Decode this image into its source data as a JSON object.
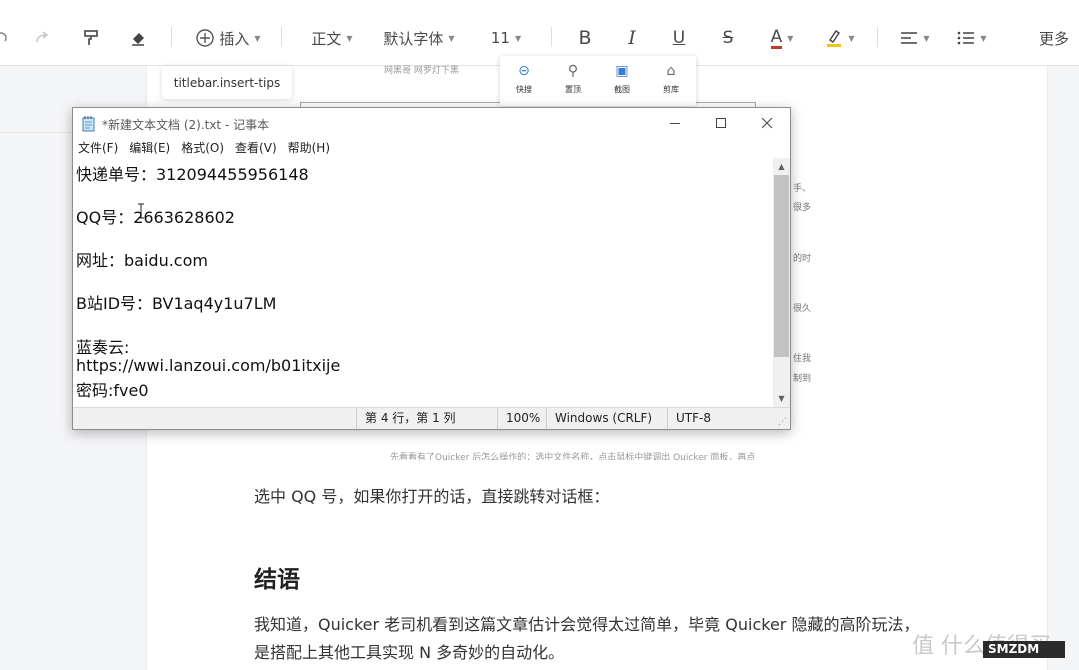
{
  "toolbar": {
    "insert_label": "插入",
    "style_value": "正文",
    "font_value": "默认字体",
    "size_value": "11",
    "bold": "B",
    "italic": "I",
    "underline": "U",
    "strike": "S",
    "font_color": "A",
    "more_label": "更多",
    "accent_color": "#c0392b",
    "highlight_color": "#f1c40f"
  },
  "tooltip": "titlebar.insert-tips",
  "background_fragments": {
    "top_text": "网黑哥   网罗灯下黑",
    "panel_items": [
      "快搜",
      "置顶",
      "截图",
      "剪库"
    ],
    "right_text": [
      "手、",
      "很多",
      "的时",
      "很久",
      "住我",
      "制到"
    ],
    "bottom_text": "先看看有了Quicker 后怎么操作的：选中文件名称，点击鼠标中键调出 Quicker 面板，再点"
  },
  "notepad": {
    "title": "*新建文本文档 (2).txt - 记事本",
    "menu": [
      "文件(F)",
      "编辑(E)",
      "格式(O)",
      "查看(V)",
      "帮助(H)"
    ],
    "lines": [
      "快递单号：312094455956148",
      "",
      "QQ号：2663628602",
      "",
      "网址：baidu.com",
      "",
      "B站ID号：BV1aq4y1u7LM",
      "",
      "蓝奏云:",
      "https://wwi.lanzoui.com/b01itxije",
      "密码:fve0"
    ],
    "status": {
      "position": "第 4 行，第 1 列",
      "zoom": "100%",
      "line_ending": "Windows (CRLF)",
      "encoding": "UTF-8"
    }
  },
  "article": {
    "para1": "选中 QQ 号，如果你打开的话，直接跳转对话框：",
    "heading": "结语",
    "para2": "我知道，Quicker 老司机看到这篇文章估计会觉得太过简单，毕竟 Quicker 隐藏的高阶玩法，",
    "para3": "是搭配上其他工具实现 N 多奇妙的自动化。"
  },
  "watermark": "值  什么值得买",
  "watermark_tag": "SMZDM"
}
